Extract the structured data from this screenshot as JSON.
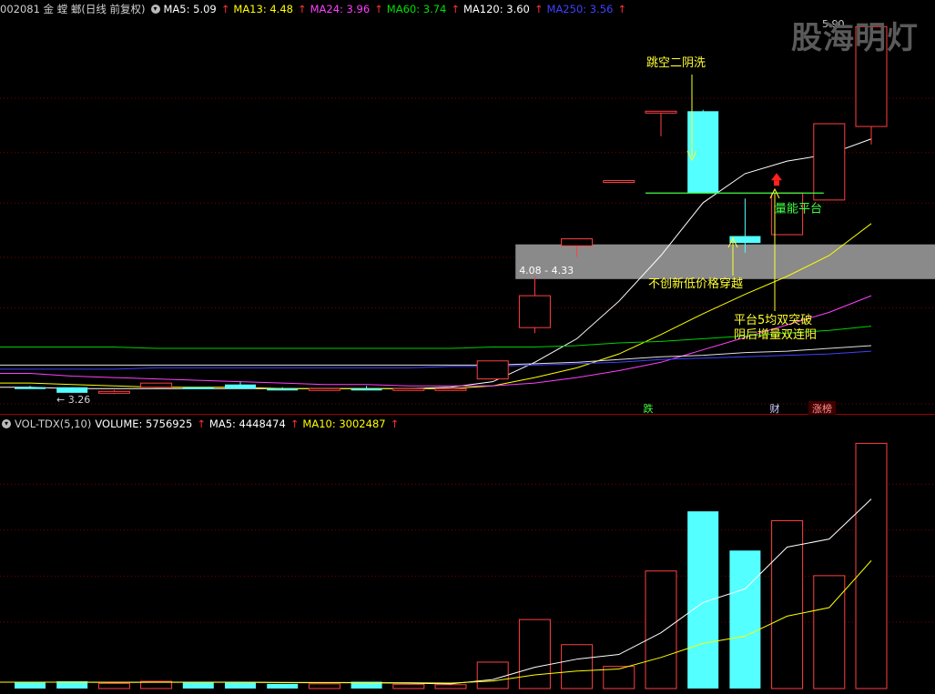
{
  "price_header": {
    "code_title": "002081 金 螳 螂(日线 前复权)",
    "indicators": [
      {
        "label": "MA5: 5.09",
        "color": "#ffffff"
      },
      {
        "label": "MA13: 4.48",
        "color": "#ffff00"
      },
      {
        "label": "MA24: 3.96",
        "color": "#ff40ff"
      },
      {
        "label": "MA60: 3.74",
        "color": "#00e000"
      },
      {
        "label": "MA120: 3.60",
        "color": "#ffffff"
      },
      {
        "label": "MA250: 3.56",
        "color": "#4040ff"
      }
    ]
  },
  "volume_header": {
    "title": "VOL-TDX(5,10)",
    "volume_label": "VOLUME: 5756925",
    "ma5_label": "MA5: 4448474",
    "ma10_label": "MA10: 3002487"
  },
  "watermark": "股海明灯",
  "annotations": {
    "gap": "跳空二阴洗",
    "platform": "量能平台",
    "no_new_low": "不创新低价格穿越",
    "breakout_line1": "平台5均双突破",
    "breakout_line2": "阴后增量双连阳",
    "range_label": "4.08 - 4.33",
    "low_label": "← 3.26",
    "high_label": "5.90",
    "tag_die": "跌",
    "tag_cai": "财",
    "tag_zhangbang": "涨榜"
  },
  "colors": {
    "up": "#ff4040",
    "down": "#54ffff",
    "grid": "#7a0000",
    "annotation": "#ffff33",
    "platform": "#40ff40",
    "zone": "#8a8a8a"
  },
  "chart_data": [
    {
      "type": "candlestick",
      "ylim": [
        3.2,
        6.0
      ],
      "x": [
        1,
        2,
        3,
        4,
        5,
        6,
        7,
        8,
        9,
        10,
        11,
        12,
        13,
        14,
        15,
        16,
        17,
        18,
        19,
        20,
        21,
        22
      ],
      "candles": [
        {
          "o": 3.3,
          "h": 3.31,
          "l": 3.29,
          "c": 3.29,
          "dir": "down"
        },
        {
          "o": 3.3,
          "h": 3.3,
          "l": 3.26,
          "c": 3.26,
          "dir": "down"
        },
        {
          "o": 3.26,
          "h": 3.28,
          "l": 3.25,
          "c": 3.27,
          "dir": "up"
        },
        {
          "o": 3.3,
          "h": 3.33,
          "l": 3.3,
          "c": 3.33,
          "dir": "up"
        },
        {
          "o": 3.3,
          "h": 3.3,
          "l": 3.29,
          "c": 3.29,
          "dir": "down"
        },
        {
          "o": 3.32,
          "h": 3.34,
          "l": 3.29,
          "c": 3.29,
          "dir": "down"
        },
        {
          "o": 3.29,
          "h": 3.3,
          "l": 3.28,
          "c": 3.29,
          "dir": "down"
        },
        {
          "o": 3.28,
          "h": 3.29,
          "l": 3.28,
          "c": 3.29,
          "dir": "up"
        },
        {
          "o": 3.29,
          "h": 3.31,
          "l": 3.28,
          "c": 3.29,
          "dir": "down"
        },
        {
          "o": 3.29,
          "h": 3.29,
          "l": 3.29,
          "c": 3.29,
          "dir": "up"
        },
        {
          "o": 3.29,
          "h": 3.29,
          "l": 3.29,
          "c": 3.29,
          "dir": "up"
        },
        {
          "o": 3.36,
          "h": 3.49,
          "l": 3.36,
          "c": 3.49,
          "dir": "up"
        },
        {
          "o": 3.73,
          "h": 4.1,
          "l": 3.69,
          "c": 3.96,
          "dir": "up"
        },
        {
          "o": 4.32,
          "h": 4.37,
          "l": 4.24,
          "c": 4.37,
          "dir": "up"
        },
        {
          "o": 4.79,
          "h": 4.79,
          "l": 4.79,
          "c": 4.79,
          "dir": "up"
        },
        {
          "o": 5.29,
          "h": 5.29,
          "l": 5.11,
          "c": 5.29,
          "dir": "up"
        },
        {
          "o": 5.29,
          "h": 5.3,
          "l": 4.7,
          "c": 4.7,
          "dir": "down"
        },
        {
          "o": 4.39,
          "h": 4.66,
          "l": 4.27,
          "c": 4.34,
          "dir": "down"
        },
        {
          "o": 4.4,
          "h": 4.7,
          "l": 4.4,
          "c": 4.7,
          "dir": "up"
        },
        {
          "o": 4.65,
          "h": 5.2,
          "l": 4.65,
          "c": 5.2,
          "dir": "up"
        },
        {
          "o": 5.18,
          "h": 5.9,
          "l": 5.05,
          "c": 5.9,
          "dir": "up"
        }
      ],
      "ma_series": [
        {
          "name": "MA5",
          "values": [
            3.3,
            3.29,
            3.29,
            3.29,
            3.29,
            3.29,
            3.29,
            3.29,
            3.29,
            3.29,
            3.3,
            3.34,
            3.48,
            3.65,
            3.92,
            4.25,
            4.63,
            4.84,
            4.93,
            4.98,
            5.09
          ]
        },
        {
          "name": "MA13",
          "values": [
            3.33,
            3.32,
            3.31,
            3.3,
            3.3,
            3.3,
            3.29,
            3.29,
            3.29,
            3.29,
            3.29,
            3.31,
            3.37,
            3.44,
            3.54,
            3.68,
            3.83,
            3.97,
            4.1,
            4.25,
            4.48
          ]
        },
        {
          "name": "MA24",
          "values": [
            3.4,
            3.38,
            3.37,
            3.36,
            3.35,
            3.34,
            3.33,
            3.32,
            3.32,
            3.31,
            3.31,
            3.31,
            3.33,
            3.37,
            3.42,
            3.48,
            3.57,
            3.66,
            3.75,
            3.84,
            3.96
          ]
        },
        {
          "name": "MA60",
          "values": [
            3.59,
            3.59,
            3.59,
            3.58,
            3.58,
            3.58,
            3.58,
            3.58,
            3.58,
            3.58,
            3.58,
            3.59,
            3.59,
            3.6,
            3.62,
            3.63,
            3.65,
            3.67,
            3.69,
            3.71,
            3.74
          ]
        },
        {
          "name": "MA120",
          "values": [
            3.46,
            3.46,
            3.46,
            3.46,
            3.46,
            3.46,
            3.46,
            3.46,
            3.46,
            3.46,
            3.46,
            3.46,
            3.47,
            3.48,
            3.5,
            3.52,
            3.53,
            3.55,
            3.56,
            3.58,
            3.6
          ]
        },
        {
          "name": "MA250",
          "values": [
            3.43,
            3.43,
            3.43,
            3.44,
            3.44,
            3.44,
            3.44,
            3.44,
            3.44,
            3.44,
            3.45,
            3.45,
            3.46,
            3.47,
            3.48,
            3.5,
            3.51,
            3.52,
            3.53,
            3.54,
            3.56
          ]
        }
      ]
    },
    {
      "type": "bar",
      "ylim": [
        0,
        6000000
      ],
      "x": [
        1,
        2,
        3,
        4,
        5,
        6,
        7,
        8,
        9,
        10,
        11,
        12,
        13,
        14,
        15,
        16,
        17,
        18,
        19,
        20,
        21,
        22
      ],
      "values": [
        150000,
        170000,
        120000,
        170000,
        140000,
        150000,
        110000,
        110000,
        160000,
        100000,
        90000,
        620000,
        1620000,
        1030000,
        520000,
        2760000,
        4160000,
        3240000,
        3940000,
        2650000,
        5756925
      ],
      "directions": [
        "down",
        "down",
        "up",
        "up",
        "down",
        "down",
        "down",
        "up",
        "down",
        "up",
        "up",
        "up",
        "up",
        "up",
        "up",
        "up",
        "down",
        "down",
        "up",
        "up",
        "up"
      ],
      "series": [
        {
          "name": "MA5",
          "values": [
            150000,
            150000,
            145000,
            150000,
            150000,
            150000,
            140000,
            135000,
            135000,
            125000,
            110000,
            210000,
            500000,
            690000,
            800000,
            1310000,
            2020000,
            2340000,
            3320000,
            3510000,
            4448474
          ]
        },
        {
          "name": "MA10",
          "values": [
            150000,
            150000,
            148000,
            148000,
            148000,
            148000,
            145000,
            142000,
            140000,
            135000,
            128000,
            175000,
            320000,
            410000,
            460000,
            730000,
            1060000,
            1230000,
            1700000,
            1900000,
            3002487
          ]
        }
      ]
    }
  ]
}
